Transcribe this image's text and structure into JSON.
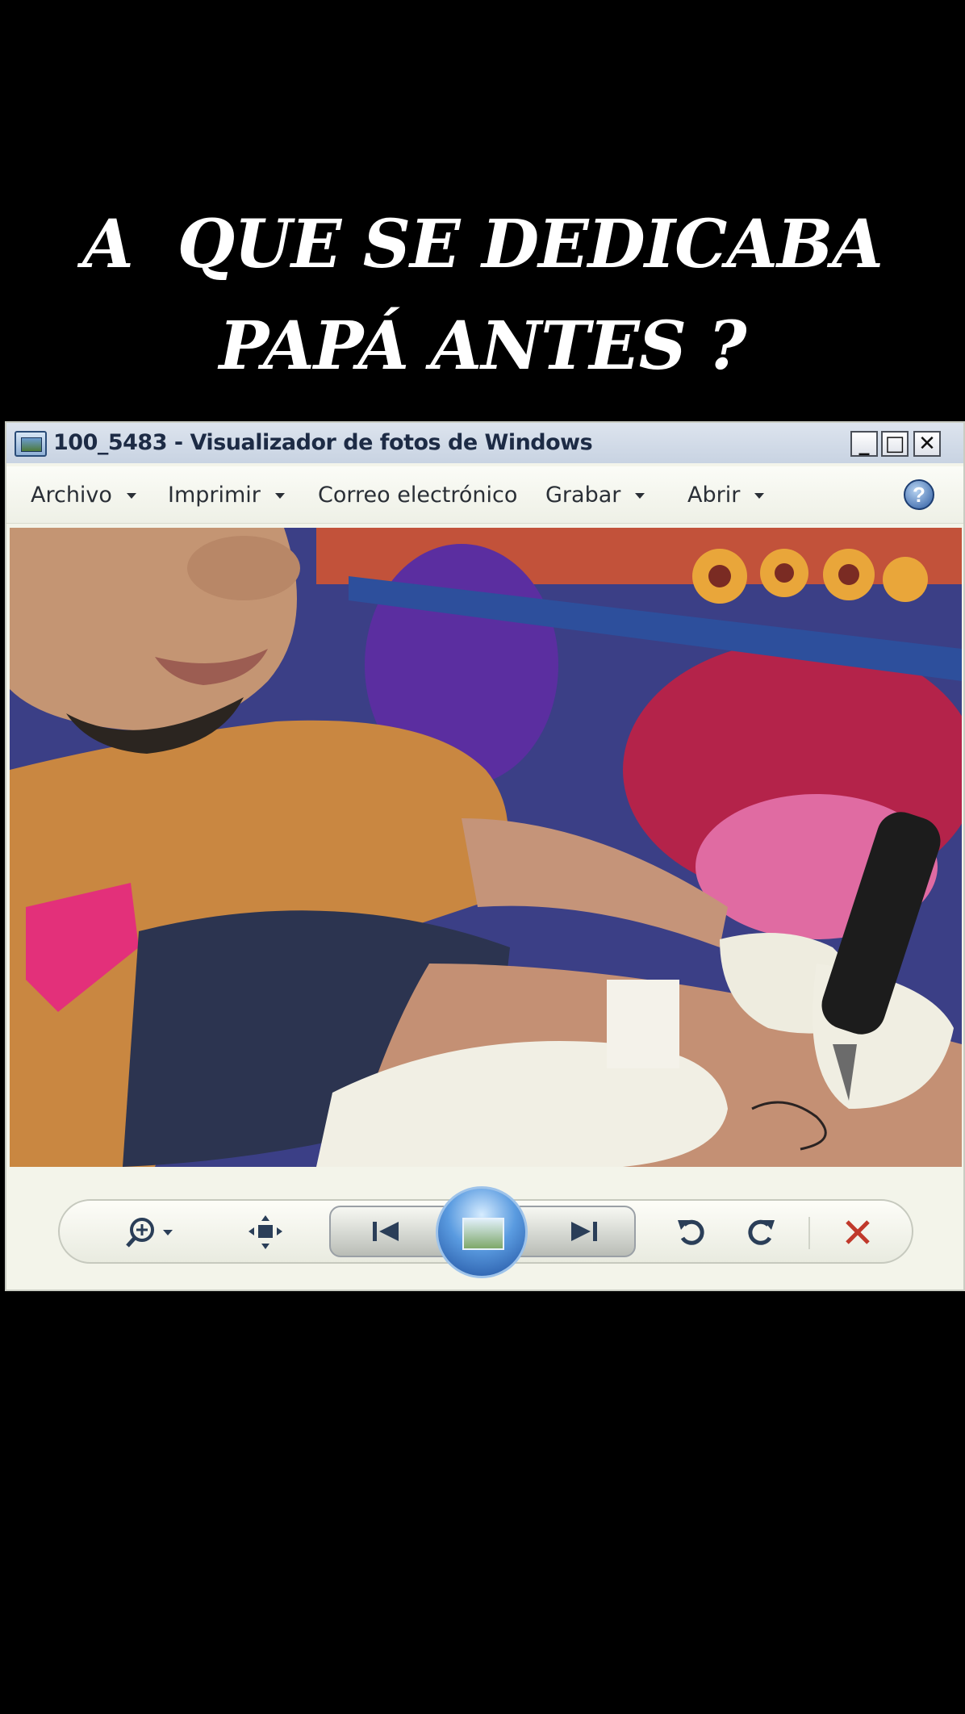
{
  "caption": {
    "line1": "A  QUE SE DEDICABA",
    "line2": "PAPÁ ANTES ?"
  },
  "window": {
    "title": "100_5483 - Visualizador de fotos de Windows",
    "buttons": {
      "minimize": "_",
      "maximize": "□",
      "close": "✕"
    }
  },
  "menu": {
    "items": [
      {
        "label": "Archivo",
        "has_dropdown": true
      },
      {
        "label": "Imprimir",
        "has_dropdown": true
      },
      {
        "label": "Correo electrónico",
        "has_dropdown": false
      },
      {
        "label": "Grabar",
        "has_dropdown": true
      },
      {
        "label": "Abrir",
        "has_dropdown": true
      }
    ],
    "help": "?"
  },
  "toolbar": {
    "icons": [
      "zoom-icon",
      "actual-size-icon",
      "previous-icon",
      "slideshow-icon",
      "next-icon",
      "rotate-left-icon",
      "rotate-right-icon",
      "delete-icon"
    ],
    "delete_color": "#c0392b"
  }
}
